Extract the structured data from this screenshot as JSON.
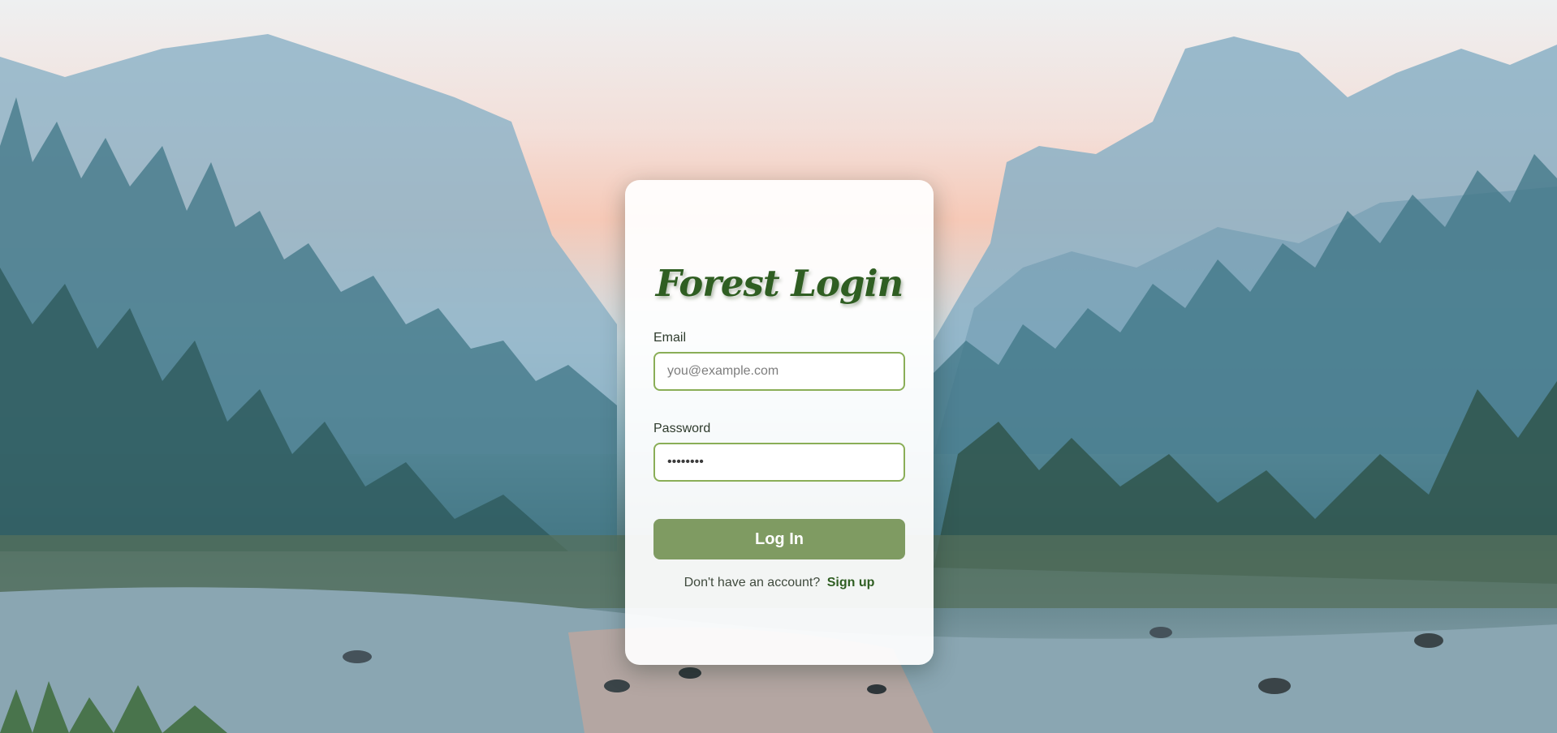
{
  "login": {
    "title": "Forest Login",
    "email_label": "Email",
    "email_placeholder": "you@example.com",
    "password_label": "Password",
    "password_value": "••••••••",
    "login_button": "Log In",
    "signup_prompt": "Don't have an account?",
    "signup_link": "Sign up"
  },
  "colors": {
    "accent": "#2f5e22",
    "button": "#7f9b62",
    "input_border": "#8aae57"
  }
}
